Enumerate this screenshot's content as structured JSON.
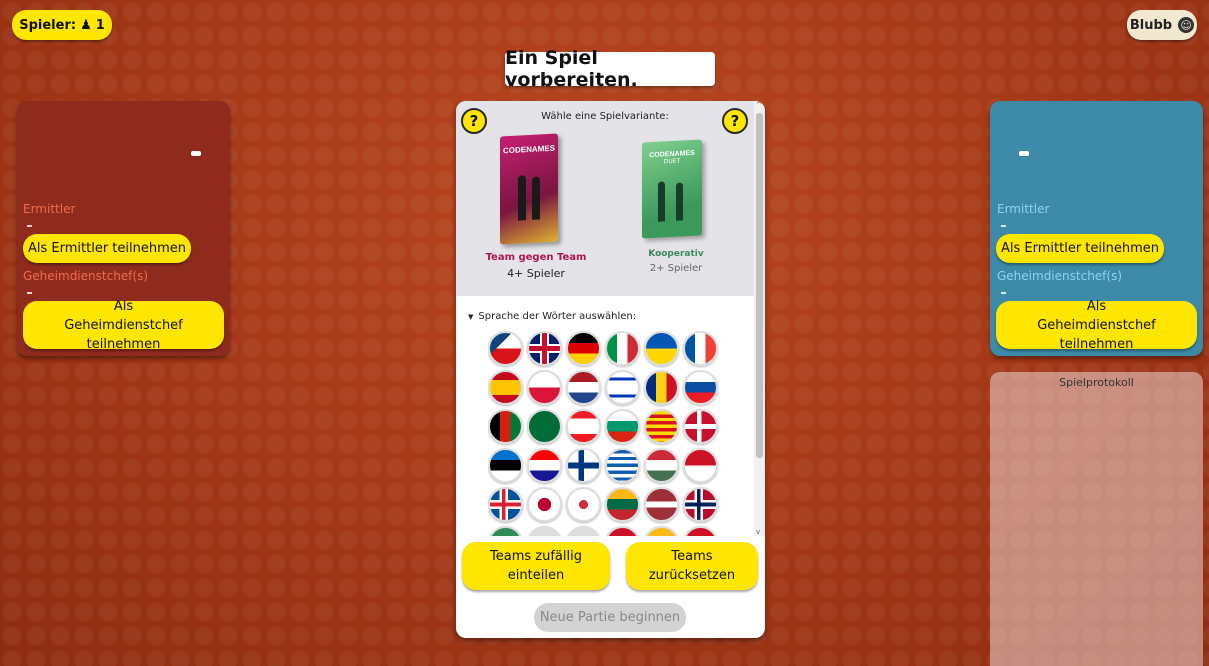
{
  "header": {
    "players_label": "Spieler:",
    "players_count": "1",
    "user_name": "Blubb",
    "title": "Ein Spiel vorbereiten."
  },
  "red_team": {
    "score": "-",
    "operatives_label": "Ermittler",
    "operatives_list": "-",
    "join_operative_button": "Als Ermittler teilnehmen",
    "spymasters_label": "Geheimdienstchef(s)",
    "spymasters_list": "-",
    "join_spymaster_button": "Als Geheimdienstchef teilnehmen"
  },
  "blue_team": {
    "score": "-",
    "operatives_label": "Ermittler",
    "operatives_list": "-",
    "join_operative_button": "Als Ermittler teilnehmen",
    "spymasters_label": "Geheimdienstchef(s)",
    "spymasters_list": "-",
    "join_spymaster_button": "Als Geheimdienstchef teilnehmen"
  },
  "game_log": {
    "title": "Spielprotokoll"
  },
  "setup": {
    "help_label": "?",
    "variant_prompt": "Wähle eine Spielvariante:",
    "variants": [
      {
        "box_title": "CODENAMES",
        "mode": "Team gegen Team",
        "players": "4+ Spieler",
        "color": "#b0164a"
      },
      {
        "box_title": "CODENAMES",
        "box_subtitle": "DUET",
        "mode": "Kooperativ",
        "players": "2+ Spieler",
        "color": "#3b8a5a"
      }
    ],
    "language_prompt": "Sprache der Wörter auswählen:",
    "flags": [
      [
        "czech-flag",
        "uk-flag",
        "german-flag",
        "italian-flag",
        "ukrainian-flag",
        "french-flag"
      ],
      [
        "spanish-flag",
        "polish-flag",
        "dutch-flag",
        "israeli-flag",
        "romanian-flag",
        "slovak-flag"
      ],
      [
        "afghan-flag",
        "saudi-flag",
        "lebanese-flag",
        "bulgarian-flag",
        "catalan-flag",
        "danish-flag"
      ],
      [
        "estonian-flag",
        "croatian-flag",
        "finnish-flag",
        "greek-flag",
        "hungarian-flag",
        "indonesian-flag"
      ],
      [
        "icelandic-flag",
        "japanese-flag",
        "korean-flag",
        "lithuanian-flag",
        "latvian-flag",
        "norwegian-flag"
      ]
    ],
    "randomize_button": "Teams zufällig einteilen",
    "reset_button": "Teams zurücksetzen",
    "start_button": "Neue Partie beginnen"
  },
  "colors": {
    "accent": "#ffe600",
    "red_team": "#8f2b1d",
    "blue_team": "#3c8aa7",
    "background": "#b8481f"
  }
}
